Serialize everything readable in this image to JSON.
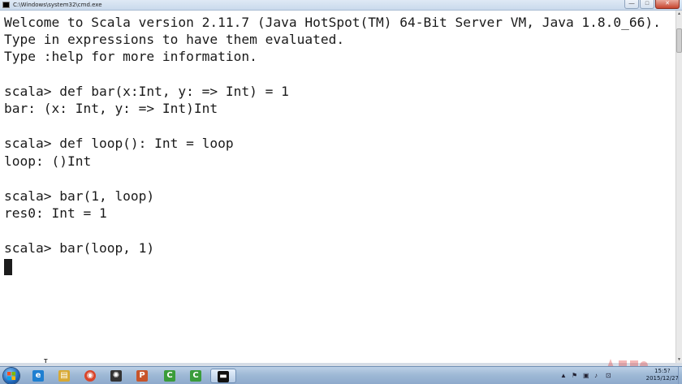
{
  "window": {
    "title": "C:\\Windows\\system32\\cmd.exe",
    "minimize_glyph": "—",
    "maximize_glyph": "□",
    "close_glyph": "✕"
  },
  "console": {
    "lines": [
      "Welcome to Scala version 2.11.7 (Java HotSpot(TM) 64-Bit Server VM, Java 1.8.0_66).",
      "Type in expressions to have them evaluated.",
      "Type :help for more information.",
      "",
      "scala> def bar(x:Int, y: => Int) = 1",
      "bar: (x: Int, y: => Int)Int",
      "",
      "scala> def loop(): Int = loop",
      "loop: ()Int",
      "",
      "scala> bar(1, loop)",
      "res0: Int = 1",
      "",
      "scala> bar(loop, 1)"
    ],
    "ibeam": "I"
  },
  "taskbar": {
    "items": [
      {
        "name": "ie-icon",
        "glyph": "e",
        "color": "#1e7fd1"
      },
      {
        "name": "explorer-icon",
        "glyph": "▤",
        "color": "#d8a933"
      },
      {
        "name": "chrome-icon",
        "glyph": "◉",
        "color": "#d9452b"
      },
      {
        "name": "app-icon",
        "glyph": "✺",
        "color": "#333333"
      },
      {
        "name": "photoshop-icon",
        "glyph": "P",
        "color": "#c8542a"
      },
      {
        "name": "camtasia-icon",
        "glyph": "C",
        "color": "#3a9c3a"
      },
      {
        "name": "camtasia-recorder-icon",
        "glyph": "C",
        "color": "#3a9c3a"
      },
      {
        "name": "cmd-icon",
        "glyph": "▬",
        "color": "#111111"
      }
    ],
    "clock_time": "15:5?",
    "clock_date": "2015/12/27",
    "tray_icons": [
      "▲",
      "⚑",
      "▣",
      "♪",
      "⊡"
    ]
  }
}
